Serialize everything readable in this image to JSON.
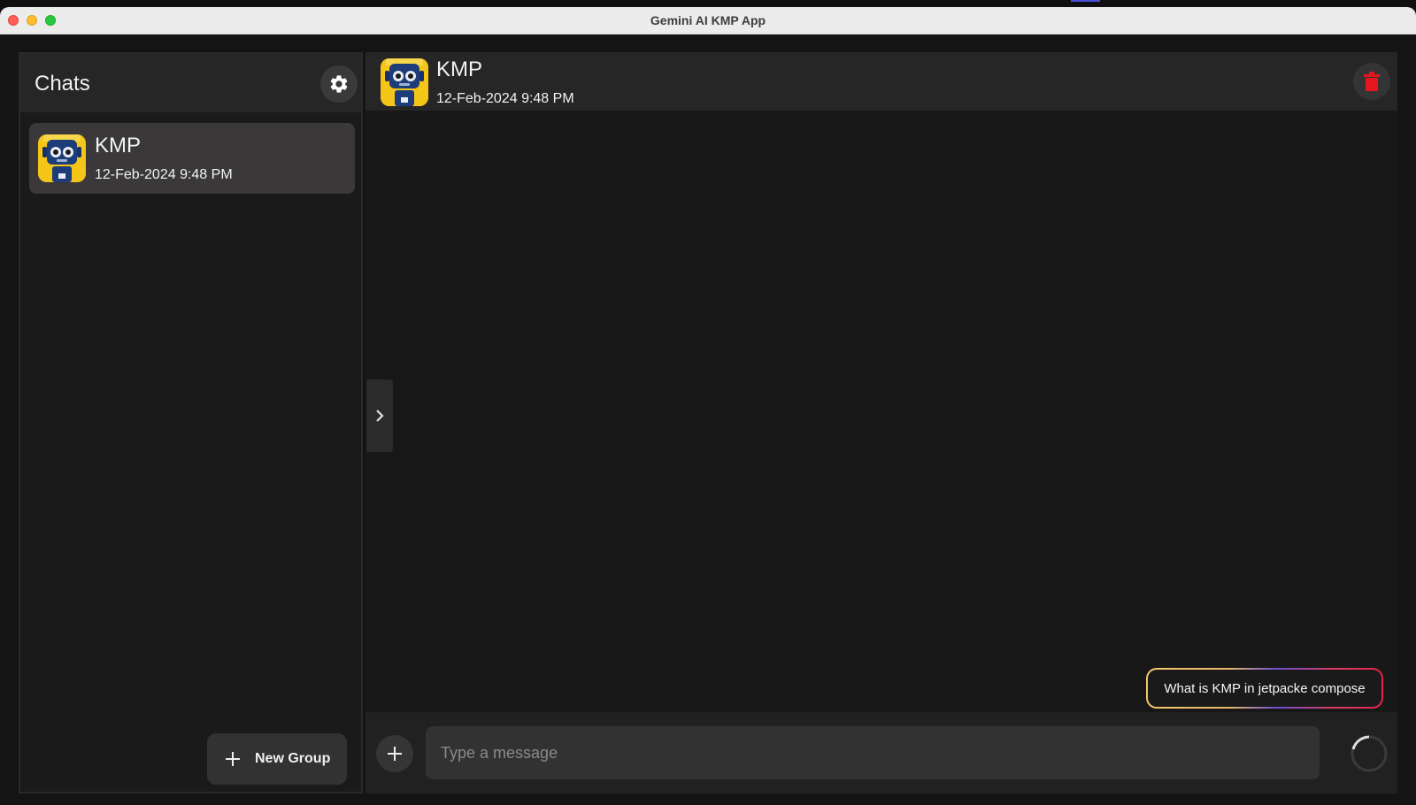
{
  "window": {
    "title": "Gemini AI KMP App"
  },
  "sidebar": {
    "title": "Chats",
    "settings_icon": "gear-icon",
    "chats": [
      {
        "name": "KMP",
        "date": "12-Feb-2024 9:48 PM",
        "avatar": "robot-avatar"
      }
    ],
    "new_group_label": "New Group"
  },
  "main": {
    "header": {
      "name": "KMP",
      "date": "12-Feb-2024 9:48 PM",
      "delete_icon": "trash-icon"
    },
    "suggestion": "What is KMP in jetpacke compose",
    "composer": {
      "placeholder": "Type a message",
      "value": ""
    }
  },
  "colors": {
    "accent_delete": "#e5171c",
    "suggestion_gradient_start": "#f3c86b",
    "suggestion_gradient_end": "#e3254b"
  }
}
